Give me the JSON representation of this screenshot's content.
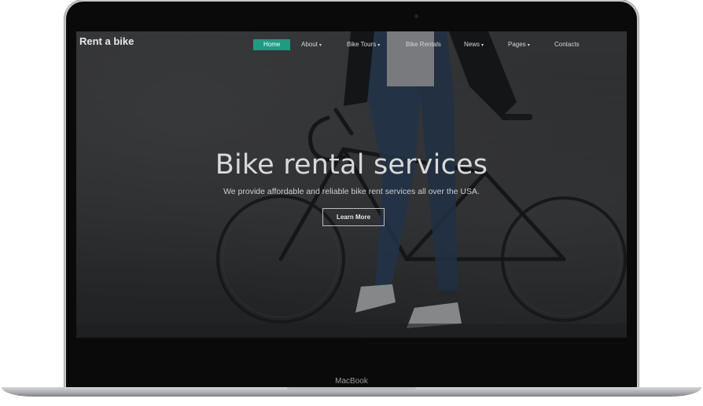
{
  "brand": "Rent a bike",
  "nav": [
    {
      "label": "Home",
      "caret": false,
      "active": true
    },
    {
      "label": "About",
      "caret": true
    },
    {
      "label": "Bike Tours",
      "caret": true
    },
    {
      "label": "Bike Rentals",
      "caret": false
    },
    {
      "label": "News",
      "caret": true
    },
    {
      "label": "Pages",
      "caret": true
    },
    {
      "label": "Contacts",
      "caret": false
    }
  ],
  "hero": {
    "title": "Bike rental services",
    "subtitle": "We provide affordable and reliable bike rent services all over the USA.",
    "cta_label": "Learn More"
  },
  "device_label": "MacBook",
  "colors": {
    "accent": "#1e9b83"
  }
}
